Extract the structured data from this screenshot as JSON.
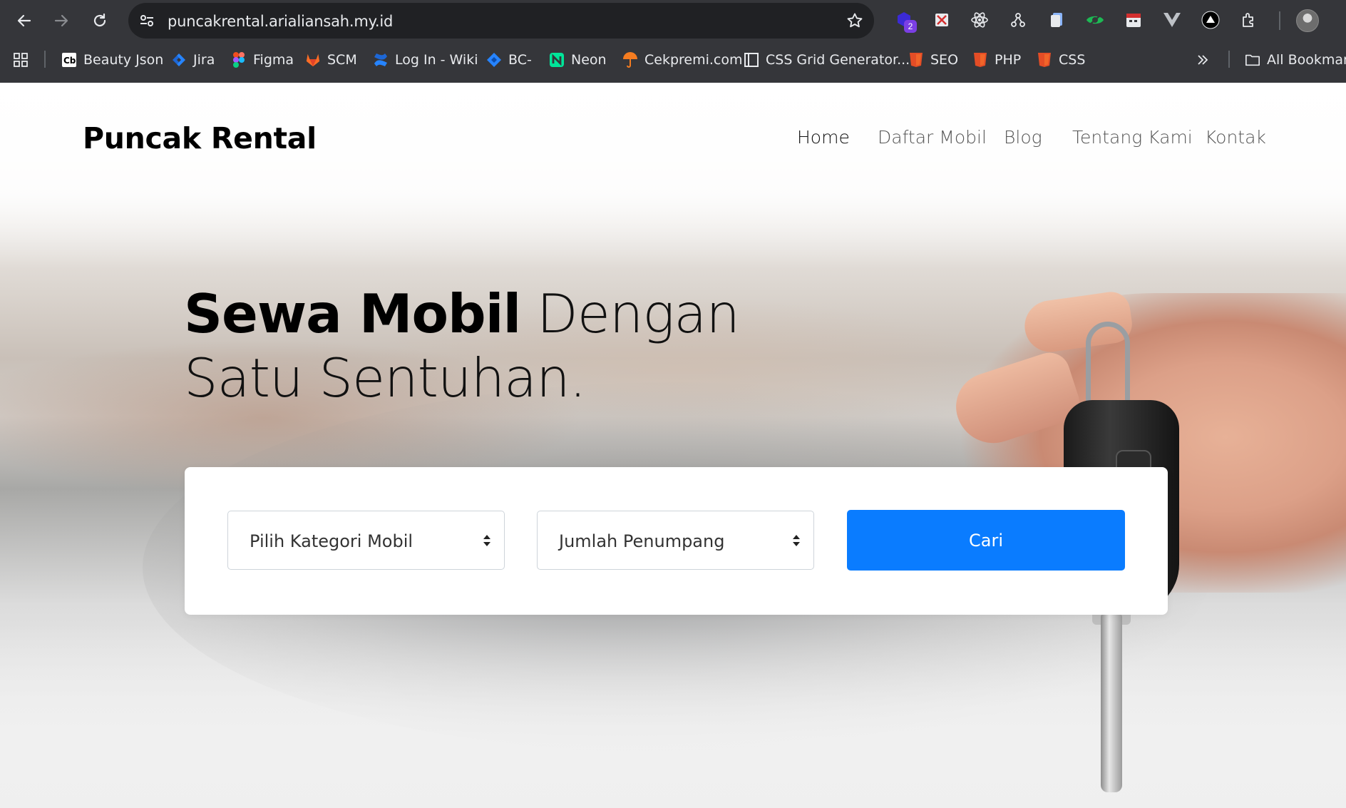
{
  "browser": {
    "url": "puncakrental.arialiansah.my.id",
    "extension_badge": "2",
    "bookmarks": [
      {
        "label": "Beauty Json",
        "icon": "cb-icon"
      },
      {
        "label": "Jira",
        "icon": "jira-icon"
      },
      {
        "label": "Figma",
        "icon": "figma-icon"
      },
      {
        "label": "SCM",
        "icon": "gitlab-icon"
      },
      {
        "label": "Log In - Wiki",
        "icon": "confluence-icon"
      },
      {
        "label": "BC-",
        "icon": "diamond-icon"
      },
      {
        "label": "Neon",
        "icon": "neon-icon"
      },
      {
        "label": "Cekpremi.com",
        "icon": "umbrella-icon"
      },
      {
        "label": "CSS Grid Generator...",
        "icon": "grid-icon"
      },
      {
        "label": "SEO",
        "icon": "html5-icon"
      },
      {
        "label": "PHP",
        "icon": "html5-icon"
      },
      {
        "label": "CSS",
        "icon": "html5-icon"
      }
    ],
    "all_bookmarks_label": "All Bookmark"
  },
  "site": {
    "brand": "Puncak Rental",
    "nav": [
      "Home",
      "Daftar Mobil",
      "Blog",
      "Tentang Kami",
      "Kontak"
    ],
    "active_nav": "Home",
    "hero": {
      "bold": "Sewa Mobil",
      "light": "Dengan",
      "line2": "Satu Sentuhan."
    },
    "search": {
      "category_select": "Pilih Kategori Mobil",
      "passenger_select": "Jumlah Penumpang",
      "submit": "Cari"
    },
    "colors": {
      "primary_button": "#0a7cff",
      "chrome_bg": "#35363a",
      "omnibox_bg": "#202124"
    }
  }
}
